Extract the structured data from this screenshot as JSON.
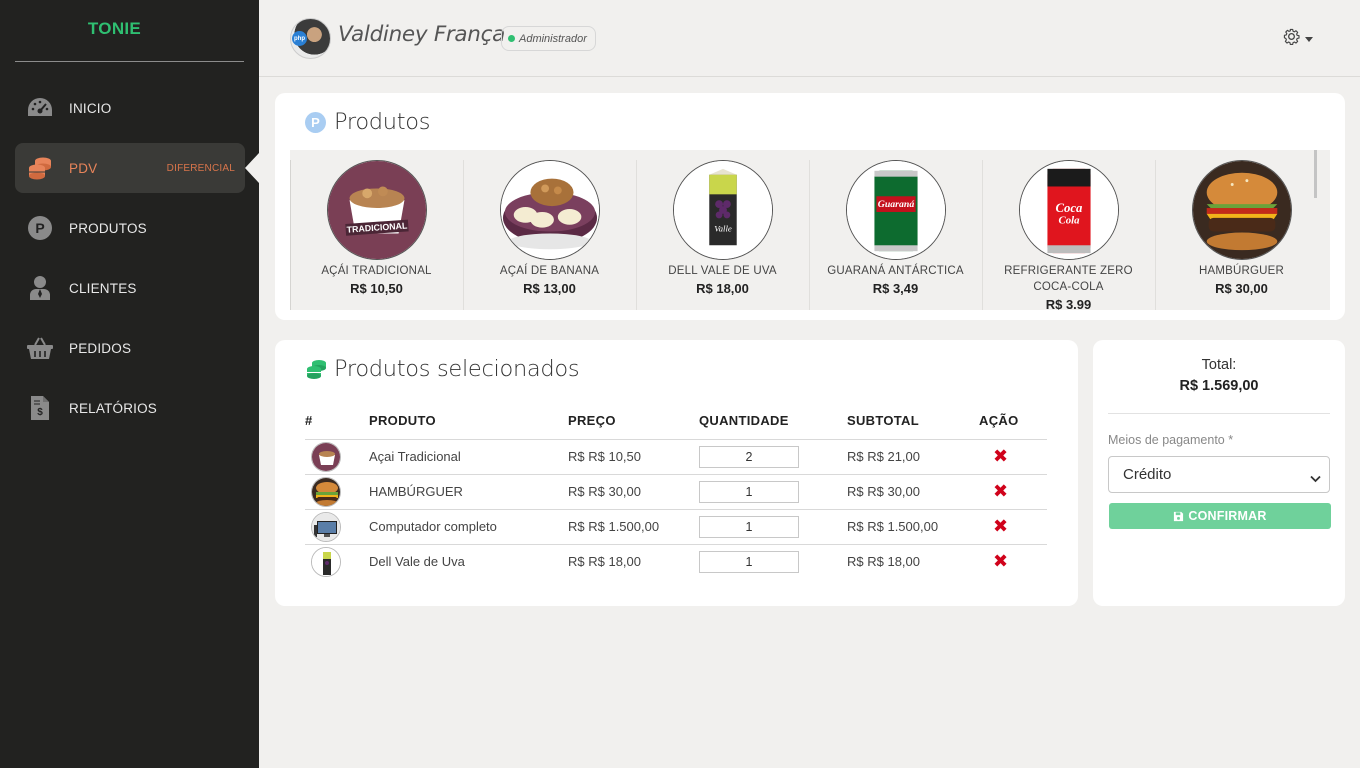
{
  "sidebar": {
    "brand": "TONIE",
    "items": [
      {
        "label": "INICIO",
        "icon": "gauge-icon"
      },
      {
        "label": "PDV",
        "icon": "coins-icon",
        "badge": "DIFERENCIAL",
        "active": true
      },
      {
        "label": "PRODUTOS",
        "icon": "p-circle-icon"
      },
      {
        "label": "CLIENTES",
        "icon": "user-icon"
      },
      {
        "label": "PEDIDOS",
        "icon": "basket-icon"
      },
      {
        "label": "RELATÓRIOS",
        "icon": "invoice-icon"
      }
    ]
  },
  "header": {
    "user_name": "Valdiney França",
    "role": "Administrador",
    "settings_icon": "gear-icon"
  },
  "products_card": {
    "title": "Produtos",
    "items": [
      {
        "name": "AÇÁI TRADICIONAL",
        "price": "R$ 10,50"
      },
      {
        "name": "AÇAÍ DE BANANA",
        "price": "R$ 13,00"
      },
      {
        "name": "DELL VALE DE UVA",
        "price": "R$ 18,00"
      },
      {
        "name": "GUARANÁ ANTÁRCTICA",
        "price": "R$ 3,49"
      },
      {
        "name": "REFRIGERANTE ZERO COCA-COLA",
        "price": "R$ 3.99"
      },
      {
        "name": "HAMBÚRGUER",
        "price": "R$ 30,00"
      }
    ]
  },
  "selected_card": {
    "title": "Produtos selecionados",
    "columns": [
      "#",
      "PRODUTO",
      "PREÇO",
      "QUANTIDADE",
      "SUBTOTAL",
      "AÇÃO"
    ],
    "rows": [
      {
        "product": "Açai Tradicional",
        "price": "R$ R$ 10,50",
        "qty": "2",
        "subtotal": "R$ R$ 21,00"
      },
      {
        "product": "HAMBÚRGUER",
        "price": "R$ R$ 30,00",
        "qty": "1",
        "subtotal": "R$ R$ 30,00"
      },
      {
        "product": "Computador completo",
        "price": "R$ R$ 1.500,00",
        "qty": "1",
        "subtotal": "R$ R$ 1.500,00"
      },
      {
        "product": "Dell Vale de Uva",
        "price": "R$ R$ 18,00",
        "qty": "1",
        "subtotal": "R$ R$ 18,00"
      }
    ]
  },
  "total_card": {
    "label": "Total:",
    "value": "R$ 1.569,00",
    "payment_label": "Meios de pagamento *",
    "payment_value": "Crédito",
    "confirm_label": "CONFIRMAR"
  },
  "colors": {
    "sidebar_bg": "#222220",
    "brand_green": "#2fbf71",
    "active_orange": "#e8845a",
    "confirm_green": "#6fd19b",
    "delete_red": "#d0021b"
  }
}
